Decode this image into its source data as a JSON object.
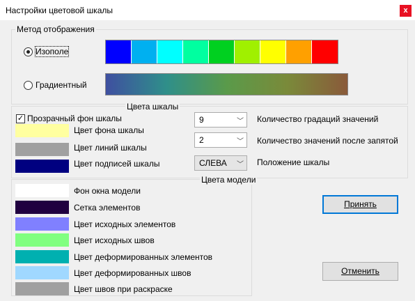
{
  "window": {
    "title": "Настройки цветовой шкалы",
    "close_label": "x"
  },
  "display_method": {
    "group_title": "Метод отображения",
    "options": [
      {
        "label": "Изополе",
        "selected": true
      },
      {
        "label": "Градиентный",
        "selected": false
      }
    ],
    "palette_colors": [
      "#0000ff",
      "#00b0f0",
      "#00ffff",
      "#00ffa0",
      "#00d020",
      "#a0f000",
      "#ffff00",
      "#ffa000",
      "#ff0000"
    ],
    "gradient_colors": [
      "#3f4fa0",
      "#2f8f8a",
      "#5a9a4a",
      "#7a8a3a",
      "#8a5a3a"
    ]
  },
  "scale_colors": {
    "group_title": "Цвета шкалы",
    "transparent_bg_label": "Прозрачный фон шкалы",
    "transparent_bg_checked": true,
    "items": [
      {
        "label": "Цвет фона шкалы",
        "color": "#ffffa0"
      },
      {
        "label": "Цвет линий шкалы",
        "color": "#a0a0a0"
      },
      {
        "label": "Цвет подписей шкалы",
        "color": "#000080"
      }
    ],
    "gradations": {
      "value": "9",
      "label": "Количество градаций значений"
    },
    "decimals": {
      "value": "2",
      "label": "Количество значений после запятой"
    },
    "position": {
      "value": "СЛЕВА",
      "label": "Положение шкалы"
    }
  },
  "model_colors": {
    "group_title": "Цвета модели",
    "items": [
      {
        "label": "Фон окна модели",
        "color": "#ffffff"
      },
      {
        "label": "Сетка элементов",
        "color": "#200040"
      },
      {
        "label": "Цвет исходных элементов",
        "color": "#8080ff"
      },
      {
        "label": "Цвет исходных швов",
        "color": "#80ff80"
      },
      {
        "label": "Цвет деформированных элементов",
        "color": "#00b0b0"
      },
      {
        "label": "Цвет деформированных швов",
        "color": "#a0d8ff"
      },
      {
        "label": "Цвет швов при раскраске",
        "color": "#a0a0a0"
      }
    ]
  },
  "buttons": {
    "accept": "Принять",
    "cancel": "Отменить"
  }
}
